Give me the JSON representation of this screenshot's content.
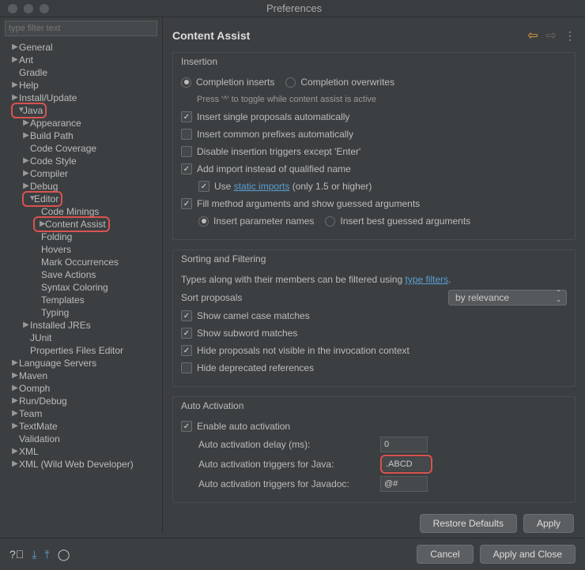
{
  "window": {
    "title": "Preferences"
  },
  "sidebar": {
    "filter_placeholder": "type filter text",
    "items": [
      {
        "label": "General",
        "depth": 1,
        "arrow": "▶"
      },
      {
        "label": "Ant",
        "depth": 1,
        "arrow": "▶"
      },
      {
        "label": "Gradle",
        "depth": 1,
        "arrow": ""
      },
      {
        "label": "Help",
        "depth": 1,
        "arrow": "▶"
      },
      {
        "label": "Install/Update",
        "depth": 1,
        "arrow": "▶"
      },
      {
        "label": "Java",
        "depth": 1,
        "arrow": "▼",
        "hl": true
      },
      {
        "label": "Appearance",
        "depth": 2,
        "arrow": "▶"
      },
      {
        "label": "Build Path",
        "depth": 2,
        "arrow": "▶"
      },
      {
        "label": "Code Coverage",
        "depth": 2,
        "arrow": ""
      },
      {
        "label": "Code Style",
        "depth": 2,
        "arrow": "▶"
      },
      {
        "label": "Compiler",
        "depth": 2,
        "arrow": "▶"
      },
      {
        "label": "Debug",
        "depth": 2,
        "arrow": "▶"
      },
      {
        "label": "Editor",
        "depth": 2,
        "arrow": "▼",
        "hl": true
      },
      {
        "label": "Code Minings",
        "depth": 3,
        "arrow": ""
      },
      {
        "label": "Content Assist",
        "depth": 3,
        "arrow": "▶",
        "hl": true
      },
      {
        "label": "Folding",
        "depth": 3,
        "arrow": ""
      },
      {
        "label": "Hovers",
        "depth": 3,
        "arrow": ""
      },
      {
        "label": "Mark Occurrences",
        "depth": 3,
        "arrow": ""
      },
      {
        "label": "Save Actions",
        "depth": 3,
        "arrow": ""
      },
      {
        "label": "Syntax Coloring",
        "depth": 3,
        "arrow": ""
      },
      {
        "label": "Templates",
        "depth": 3,
        "arrow": ""
      },
      {
        "label": "Typing",
        "depth": 3,
        "arrow": ""
      },
      {
        "label": "Installed JREs",
        "depth": 2,
        "arrow": "▶"
      },
      {
        "label": "JUnit",
        "depth": 2,
        "arrow": ""
      },
      {
        "label": "Properties Files Editor",
        "depth": 2,
        "arrow": ""
      },
      {
        "label": "Language Servers",
        "depth": 1,
        "arrow": "▶"
      },
      {
        "label": "Maven",
        "depth": 1,
        "arrow": "▶"
      },
      {
        "label": "Oomph",
        "depth": 1,
        "arrow": "▶"
      },
      {
        "label": "Run/Debug",
        "depth": 1,
        "arrow": "▶"
      },
      {
        "label": "Team",
        "depth": 1,
        "arrow": "▶"
      },
      {
        "label": "TextMate",
        "depth": 1,
        "arrow": "▶"
      },
      {
        "label": "Validation",
        "depth": 1,
        "arrow": ""
      },
      {
        "label": "XML",
        "depth": 1,
        "arrow": "▶"
      },
      {
        "label": "XML (Wild Web Developer)",
        "depth": 1,
        "arrow": "▶"
      }
    ]
  },
  "main": {
    "title": "Content Assist",
    "insertion": {
      "title": "Insertion",
      "completion_inserts": "Completion inserts",
      "completion_overwrites": "Completion overwrites",
      "toggle_hint": "Press '^' to toggle while content assist is active",
      "opt_single": "Insert single proposals automatically",
      "opt_prefix": "Insert common prefixes automatically",
      "opt_disable_enter": "Disable insertion triggers except 'Enter'",
      "opt_import": "Add import instead of qualified name",
      "use_static_pre": "Use ",
      "use_static_link": "static imports",
      "use_static_post": " (only 1.5 or higher)",
      "opt_fill": "Fill method arguments and show guessed arguments",
      "radio_param": "Insert parameter names",
      "radio_guess": "Insert best guessed arguments"
    },
    "sorting": {
      "title": "Sorting and Filtering",
      "filter_hint_pre": "Types along with their members can be filtered using ",
      "filter_hint_link": "type filters",
      "filter_hint_post": ".",
      "sort_label": "Sort proposals",
      "sort_value": "by relevance",
      "opt_camel": "Show camel case matches",
      "opt_subword": "Show subword matches",
      "opt_hide_invoc": "Hide proposals not visible in the invocation context",
      "opt_hide_depr": "Hide deprecated references"
    },
    "auto": {
      "title": "Auto Activation",
      "opt_enable": "Enable auto activation",
      "delay_label": "Auto activation delay (ms):",
      "delay_value": "0",
      "java_label": "Auto activation triggers for Java:",
      "java_value": ".ABCD",
      "javadoc_label": "Auto activation triggers for Javadoc:",
      "javadoc_value": "@#"
    },
    "buttons": {
      "restore": "Restore Defaults",
      "apply": "Apply",
      "cancel": "Cancel",
      "apply_close": "Apply and Close"
    }
  }
}
